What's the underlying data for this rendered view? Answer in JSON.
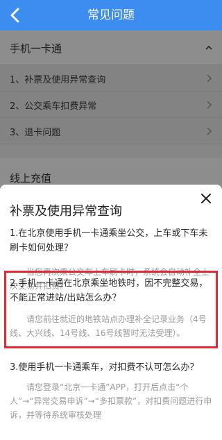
{
  "header": {
    "title": "常见问题"
  },
  "background": {
    "section1": {
      "title": "手机一卡通",
      "items": [
        "1、补票及使用异常查询",
        "2、公交乘车扣费异常",
        "3、退卡问题"
      ]
    },
    "section2": {
      "title": "线上充值"
    }
  },
  "sheet": {
    "title": "补票及使用异常查询",
    "faqs": [
      {
        "question": "1.在北京使用手机一卡通乘坐公交，上车或下车未刷卡如何处理？",
        "answer": "当您再次乘公交车上车刷卡时，系统会自动补全上次交易并扣费。"
      },
      {
        "question": "2.手机一卡通在北京乘坐地铁时，因不完整交易，不能正常进站/出站怎么办？",
        "answer": "请您前往就近的地铁站点办理补全记录业务（4号线、大兴线、14号线、16号线暂时无法受理）。"
      },
      {
        "question": "3.使用手机一卡通乘车，对扣费不认可怎么办？",
        "answer": "请您登录“北京一卡通”APP，打开后点击“个人”→“异常交易申诉”→“多扣票款”，对扣费问题进行申诉，并等待系统审核处理"
      }
    ]
  },
  "colors": {
    "header": "#3d8cf0",
    "highlight": "#e12a35"
  },
  "icons": {
    "back": "chevron-left-icon",
    "close": "close-icon",
    "row": "chevron-right-icon",
    "section": "chevron-up-icon"
  }
}
